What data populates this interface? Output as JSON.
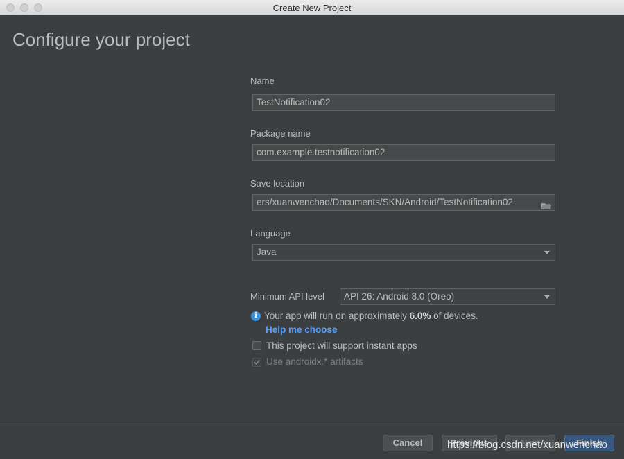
{
  "window": {
    "title": "Create New Project"
  },
  "page": {
    "title": "Configure your project"
  },
  "form": {
    "name_label": "Name",
    "name_value": "TestNotification02",
    "package_label": "Package name",
    "package_value": "com.example.testnotification02",
    "location_label": "Save location",
    "location_value": "ers/xuanwenchao/Documents/SKN/Android/TestNotification02",
    "language_label": "Language",
    "language_value": "Java",
    "api_label": "Minimum API level",
    "api_value": "API 26: Android 8.0 (Oreo)",
    "info_pre": "Your app will run on approximately ",
    "info_percent": "6.0%",
    "info_post": " of devices.",
    "help_link": "Help me choose",
    "instant_label": "This project will support instant apps",
    "androidx_label": "Use androidx.* artifacts"
  },
  "buttons": {
    "cancel": "Cancel",
    "previous": "Previous",
    "next": "Next",
    "finish": "Finish"
  },
  "watermark": "https://blog.csdn.net/xuanwenchao",
  "colors": {
    "background": "#3c3f41",
    "accent": "#589df6",
    "finish_button": "#365880"
  }
}
